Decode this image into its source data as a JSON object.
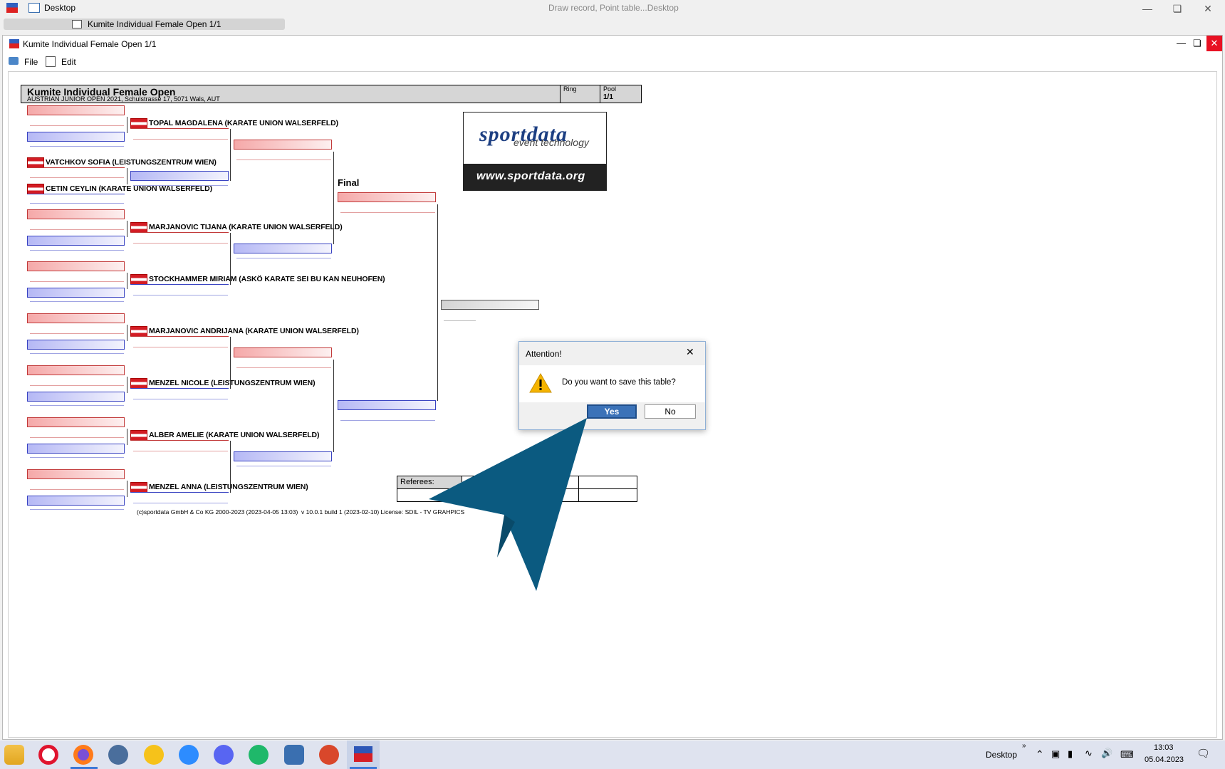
{
  "window": {
    "desktop_label": "Desktop",
    "center_title": "Draw record, Point table...Desktop",
    "tab_label": "Kumite Individual Female Open 1/1"
  },
  "inner_window": {
    "title": "Kumite Individual Female Open 1/1",
    "menu": {
      "file": "File",
      "edit": "Edit"
    }
  },
  "sheet": {
    "title": "Kumite Individual Female Open",
    "subtitle": "AUSTRIAN JUNIOR OPEN 2021, Schulstrasse 17, 5071 Wals, AUT",
    "ring_label": "Ring",
    "pool_label": "Pool",
    "pool_value": "1/1",
    "final_label": "Final",
    "referees_label": "Referees:",
    "logo_main": "sportdata",
    "logo_sub": "event technology",
    "logo_url": "www.sportdata.org",
    "footer": "(c)sportdata GmbH & Co KG 2000-2023 (2023-04-05 13:03)  v 10.0.1 build 1 (2023-02-10) License: SDIL - TV GRAHPICS                     23-12-31)"
  },
  "bracket": {
    "round1_names": [
      "VATCHKOV SOFIA (LEISTUNGSZENTRUM WIEN)",
      "CETIN CEYLIN (KARATE UNION WALSERFELD)"
    ],
    "round2_names": [
      "TOPAL MAGDALENA (KARATE UNION WALSERFELD)",
      "MARJANOVIC TIJANA (KARATE UNION WALSERFELD)",
      "STOCKHAMMER MIRIAM (ASKÖ KARATE SEI BU KAN NEUHOFEN)",
      "MARJANOVIC ANDRIJANA (KARATE UNION WALSERFELD)",
      "MENZEL NICOLE (LEISTUNGSZENTRUM WIEN)",
      "ALBER AMELIE (KARATE UNION WALSERFELD)",
      "MENZEL ANNA (LEISTUNGSZENTRUM WIEN)"
    ]
  },
  "dialog": {
    "title": "Attention!",
    "message": "Do you want to save this table?",
    "yes": "Yes",
    "no": "No"
  },
  "taskbar": {
    "desktop_label": "Desktop",
    "time": "13:03",
    "date": "05.04.2023"
  },
  "colors": {
    "pointer_arrow": "#0b5a80",
    "yes_button": "#3b72b8",
    "red_slot": "#c23a3a",
    "blue_slot": "#3a44c2"
  }
}
